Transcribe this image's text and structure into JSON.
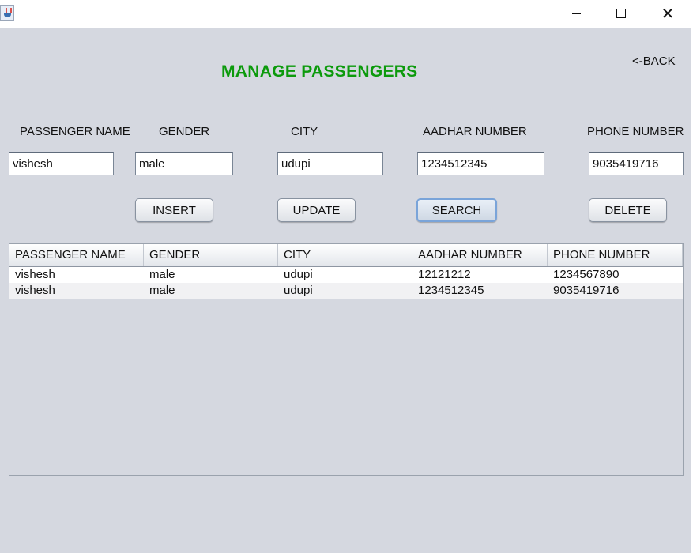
{
  "window": {
    "icon": "java-cup-icon",
    "controls": [
      "minimize-icon",
      "maximize-icon",
      "close-icon"
    ]
  },
  "page": {
    "title": "MANAGE PASSENGERS",
    "back_label": "<-BACK"
  },
  "form": {
    "labels": {
      "passenger_name": "PASSENGER NAME",
      "gender": "GENDER",
      "city": "CITY",
      "aadhar": "AADHAR NUMBER",
      "phone": "PHONE NUMBER"
    },
    "values": {
      "passenger_name": "vishesh",
      "gender": "male",
      "city": "udupi",
      "aadhar": "1234512345",
      "phone": "9035419716"
    }
  },
  "buttons": {
    "insert": "INSERT",
    "update": "UPDATE",
    "search": "SEARCH",
    "delete": "DELETE"
  },
  "table": {
    "columns": [
      "PASSENGER NAME",
      "GENDER",
      "CITY",
      "AADHAR NUMBER",
      "PHONE NUMBER"
    ],
    "rows": [
      [
        "vishesh",
        "male",
        "udupi",
        "12121212",
        "1234567890"
      ],
      [
        "vishesh",
        "male",
        "udupi",
        "1234512345",
        "9035419716"
      ]
    ]
  },
  "colors": {
    "title": "#0c9a0c",
    "panel_background": "#d5d8e0"
  }
}
